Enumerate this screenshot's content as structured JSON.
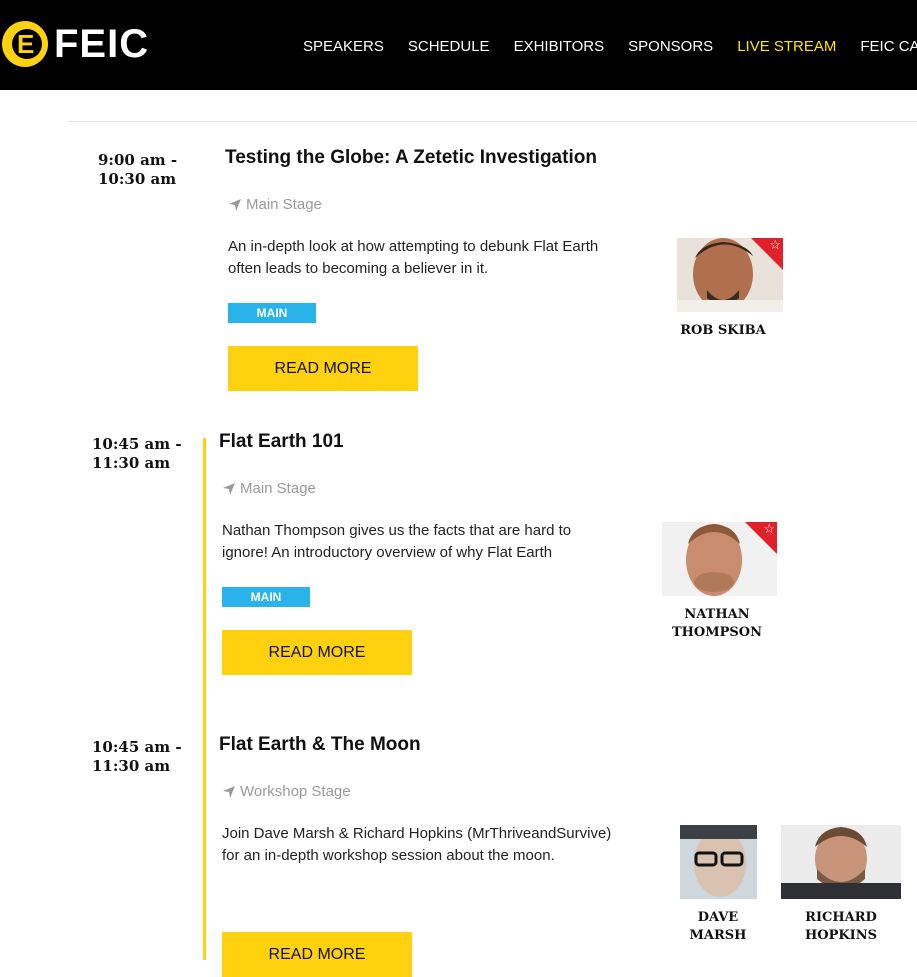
{
  "header": {
    "logo_text": "FEIC",
    "nav": [
      "SPEAKERS",
      "SCHEDULE",
      "EXHIBITORS",
      "SPONSORS",
      "LIVE STREAM",
      "FEIC CANADA"
    ],
    "active_color": "#ffe600",
    "brand_yellow": "#ffd10f"
  },
  "events": [
    {
      "time": "9:00 am - 10:30 am",
      "title": "Testing the Globe: A Zetetic Investigation",
      "location": "Main Stage",
      "location_icon": "location-arrow-icon",
      "description": "An in-depth look at how attempting to debunk Flat Earth often leads to becoming a believer in it.",
      "tag": "MAIN",
      "button": "READ MORE",
      "speakers": [
        "ROB SKIBA"
      ]
    },
    {
      "time": "10:45 am - 11:30 am",
      "title": "Flat Earth 101",
      "location": "Main Stage",
      "location_icon": "location-arrow-icon",
      "description": "Nathan Thompson gives us the facts that are hard to ignore! An introductory overview of why Flat Earth",
      "tag": "MAIN",
      "button": "READ MORE",
      "speakers": [
        "NATHAN THOMPSON"
      ]
    },
    {
      "time": "10:45 am - 11:30 am",
      "title": "Flat Earth & The Moon",
      "location": "Workshop Stage",
      "location_icon": "location-arrow-icon",
      "description": "Join Dave Marsh & Richard Hopkins (MrThriveandSurvive) for an in-depth workshop session about the moon.",
      "button": "READ MORE",
      "speakers": [
        "DAVE MARSH",
        "RICHARD HOPKINS"
      ]
    }
  ]
}
